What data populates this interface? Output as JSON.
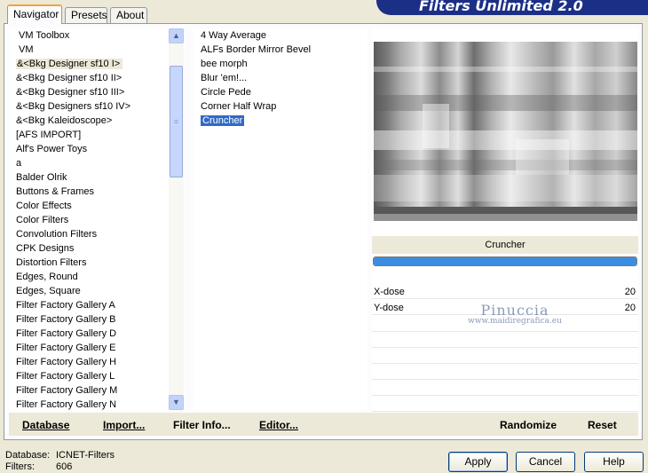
{
  "tabs": [
    {
      "label": "Navigator",
      "active": true
    },
    {
      "label": "Presets",
      "active": false
    },
    {
      "label": "About",
      "active": false
    }
  ],
  "title": "Filters Unlimited 2.0",
  "categories": [
    "VM Toolbox",
    "VM",
    "&<Bkg Designer sf10 I>",
    "&<Bkg Designer sf10 II>",
    "&<Bkg Designer sf10 III>",
    "&<Bkg Designers sf10 IV>",
    "&<Bkg Kaleidoscope>",
    "[AFS IMPORT]",
    "Alf's Power Toys",
    "a",
    "Balder Olrik",
    "Buttons & Frames",
    "Color Effects",
    "Color Filters",
    "Convolution Filters",
    "CPK Designs",
    "Distortion Filters",
    "Edges, Round",
    "Edges, Square",
    "Filter Factory Gallery A",
    "Filter Factory Gallery B",
    "Filter Factory Gallery D",
    "Filter Factory Gallery E",
    "Filter Factory Gallery H",
    "Filter Factory Gallery L",
    "Filter Factory Gallery M",
    "Filter Factory Gallery N"
  ],
  "selected_category": "&<Bkg Designer sf10 I>",
  "filters": [
    "4 Way Average",
    "ALFs Border Mirror Bevel",
    "bee morph",
    "Blur 'em!...",
    "Circle Pede",
    "Corner Half Wrap",
    "Cruncher"
  ],
  "selected_filter": "Cruncher",
  "preview": {
    "filter_name": "Cruncher",
    "progress": 1.0
  },
  "params": [
    {
      "label": "X-dose",
      "value": "20"
    },
    {
      "label": "Y-dose",
      "value": "20"
    }
  ],
  "watermark": {
    "main": "Pinuccia",
    "url": "www.maidiregrafica.eu"
  },
  "toolbar": {
    "database": "Database",
    "import": "Import...",
    "filter_info": "Filter Info...",
    "editor": "Editor...",
    "randomize": "Randomize",
    "reset": "Reset"
  },
  "status": {
    "database_label": "Database:",
    "database_value": "ICNET-Filters",
    "filters_label": "Filters:",
    "filters_value": "606"
  },
  "buttons": {
    "apply": "Apply",
    "cancel": "Cancel",
    "help": "Help"
  },
  "colors": {
    "banner": "#1c2f87",
    "selection": "#316ac5",
    "progress": "#3c8de0"
  }
}
